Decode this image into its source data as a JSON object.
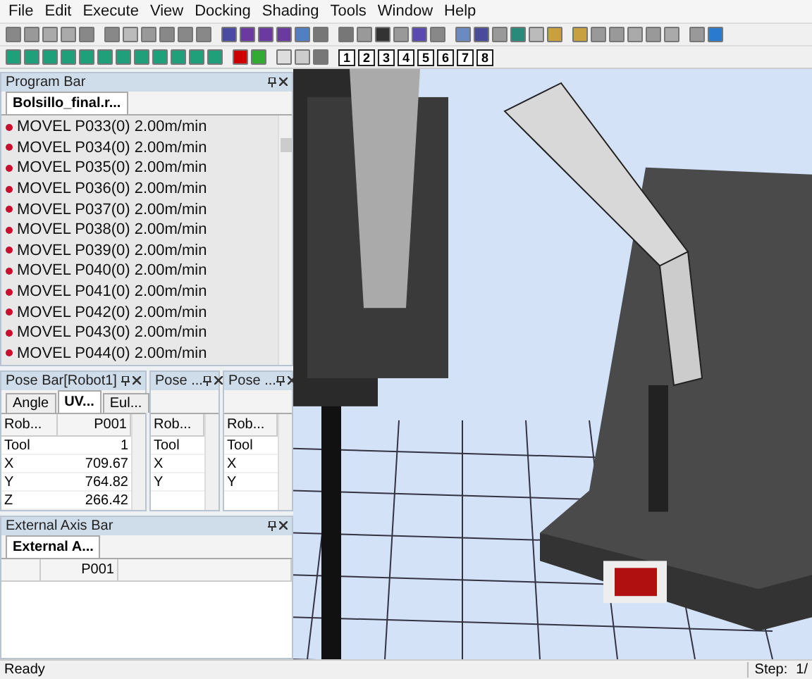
{
  "menu": [
    "File",
    "Edit",
    "Execute",
    "View",
    "Docking",
    "Shading",
    "Tools",
    "Window",
    "Help"
  ],
  "view_buttons": [
    "1",
    "2",
    "3",
    "4",
    "5",
    "6",
    "7",
    "8"
  ],
  "program_bar": {
    "title": "Program Bar",
    "tabs": [
      {
        "label": "Bolsillo_final.r...",
        "selected": true
      }
    ],
    "rows": [
      "MOVEL P033(0) 2.00m/min",
      "MOVEL P034(0) 2.00m/min",
      "MOVEL P035(0) 2.00m/min",
      "MOVEL P036(0) 2.00m/min",
      "MOVEL P037(0) 2.00m/min",
      "MOVEL P038(0) 2.00m/min",
      "MOVEL P039(0) 2.00m/min",
      "MOVEL P040(0) 2.00m/min",
      "MOVEL P041(0) 2.00m/min",
      "MOVEL P042(0) 2.00m/min",
      "MOVEL P043(0) 2.00m/min",
      "MOVEL P044(0) 2.00m/min"
    ]
  },
  "pose_bars": [
    {
      "title": "Pose Bar[Robot1]",
      "tabs": [
        {
          "label": "Angle",
          "selected": false
        },
        {
          "label": "UV...",
          "selected": true
        },
        {
          "label": "Eul...",
          "selected": false
        }
      ],
      "columns": [
        "Rob...",
        "P001"
      ],
      "rows": [
        [
          "Tool",
          "1"
        ],
        [
          "X",
          "709.67"
        ],
        [
          "Y",
          "764.82"
        ],
        [
          "Z",
          "266.42"
        ]
      ]
    },
    {
      "title": "Pose ...",
      "columns": [
        "Rob..."
      ],
      "rows": [
        [
          "Tool"
        ],
        [
          "X"
        ],
        [
          "Y"
        ]
      ]
    },
    {
      "title": "Pose ...",
      "columns": [
        "Rob..."
      ],
      "rows": [
        [
          "Tool"
        ],
        [
          "X"
        ],
        [
          "Y"
        ]
      ]
    }
  ],
  "external_axis_bar": {
    "title": "External Axis Bar",
    "tabs": [
      {
        "label": "External A...",
        "selected": true
      }
    ],
    "columns": [
      "",
      "P001"
    ]
  },
  "status_bar": {
    "text": "Ready",
    "step_label": "Step:",
    "step_value": "1/"
  }
}
